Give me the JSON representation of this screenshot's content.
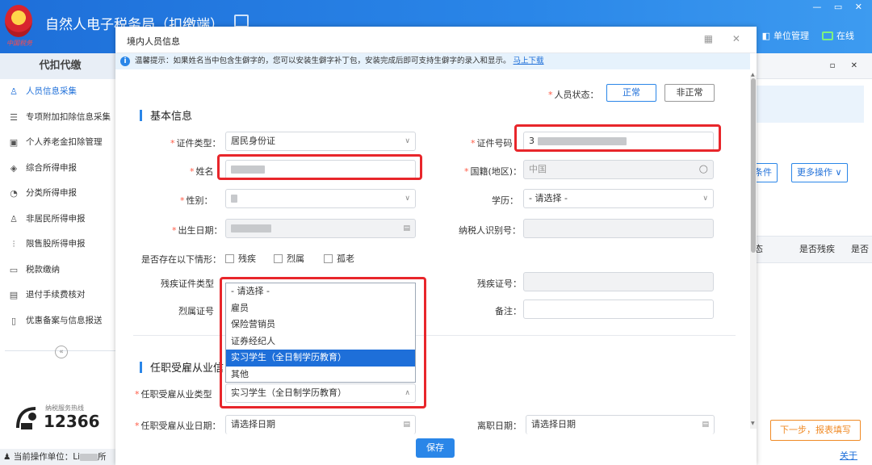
{
  "app": {
    "title": "自然人电子税务局（扣缴端）",
    "emblem_caption": "中国税务",
    "unit_mgmt": "单位管理",
    "online": "在线",
    "window_controls": "— ▭ ✕"
  },
  "sidebar": {
    "header": "代扣代缴",
    "items": [
      {
        "label": "人员信息采集",
        "icon": "person-icon",
        "glyph": "♙"
      },
      {
        "label": "专项附加扣除信息采集",
        "icon": "list-icon",
        "glyph": "☰"
      },
      {
        "label": "个人养老金扣除管理",
        "icon": "pension-icon",
        "glyph": "▣"
      },
      {
        "label": "综合所得申报",
        "icon": "layers-icon",
        "glyph": "◈"
      },
      {
        "label": "分类所得申报",
        "icon": "pie-icon",
        "glyph": "◔"
      },
      {
        "label": "非居民所得申报",
        "icon": "user-foreign-icon",
        "glyph": "♙"
      },
      {
        "label": "限售股所得申报",
        "icon": "bar-chart-icon",
        "glyph": "⫶"
      },
      {
        "label": "税款缴纳",
        "icon": "wallet-icon",
        "glyph": "▭"
      },
      {
        "label": "退付手续费核对",
        "icon": "receipt-icon",
        "glyph": "▤"
      },
      {
        "label": "优惠备案与信息报送",
        "icon": "document-icon",
        "glyph": "▯"
      }
    ],
    "collapse": "«",
    "hotline_caption": "纳税服务热线",
    "hotline_number": "12366",
    "status_prefix": "当前操作单位：Li",
    "status_suffix": "所"
  },
  "right_panel": {
    "ctrls": "▫ ✕",
    "btn_conditions": "条件",
    "btn_more": "更多操作 ∨",
    "col_status": "态",
    "col_disabled": "是否残疾",
    "col_more": "是否",
    "next_btn": "下一步，报表填写",
    "close": "关于"
  },
  "modal": {
    "title": "境内人员信息",
    "ctrls": "▦ ✕",
    "tip_text": "温馨提示：如果姓名当中包含生僻字的，您可以安装生僻字补丁包，安装完成后即可支持生僻字的录入和显示。",
    "tip_link": "马上下载",
    "status_label": "人员状态：",
    "status_normal": "正常",
    "status_abnormal": "非正常",
    "basic_section": "基本信息",
    "id_type_label": "证件类型：",
    "id_type_value": "居民身份证",
    "id_no_label": "证件号码",
    "id_no_prefix": "3",
    "name_label": "姓名",
    "nationality_label": "国籍(地区)：",
    "nationality_value": "中国",
    "gender_label": "性别：",
    "education_label": "学历：",
    "education_value": "- 请选择 -",
    "birth_label": "出生日期：",
    "taxid_label": "纳税人识别号：",
    "special_label": "是否存在以下情形：",
    "chk_disabled": "残疾",
    "chk_martyr": "烈属",
    "chk_elderly": "孤老",
    "disab_type_label": "残疾证件类型",
    "disab_no_label": "残疾证号：",
    "martyr_no_label": "烈属证号",
    "remark_label": "备注：",
    "employment_section": "任职受雇从业信",
    "emp_type_label": "任职受雇从业类型",
    "emp_type_value": "实习学生（全日制学历教育）",
    "emp_date_label": "任职受雇从业日期：",
    "emp_date_placeholder": "请选择日期",
    "leave_date_label": "离职日期：",
    "leave_date_placeholder": "请选择日期",
    "save": "保存",
    "dropdown_options": [
      "- 请选择 -",
      "雇员",
      "保险营销员",
      "证券经纪人",
      "实习学生（全日制学历教育）",
      "其他"
    ],
    "dropdown_selected_index": 4
  }
}
